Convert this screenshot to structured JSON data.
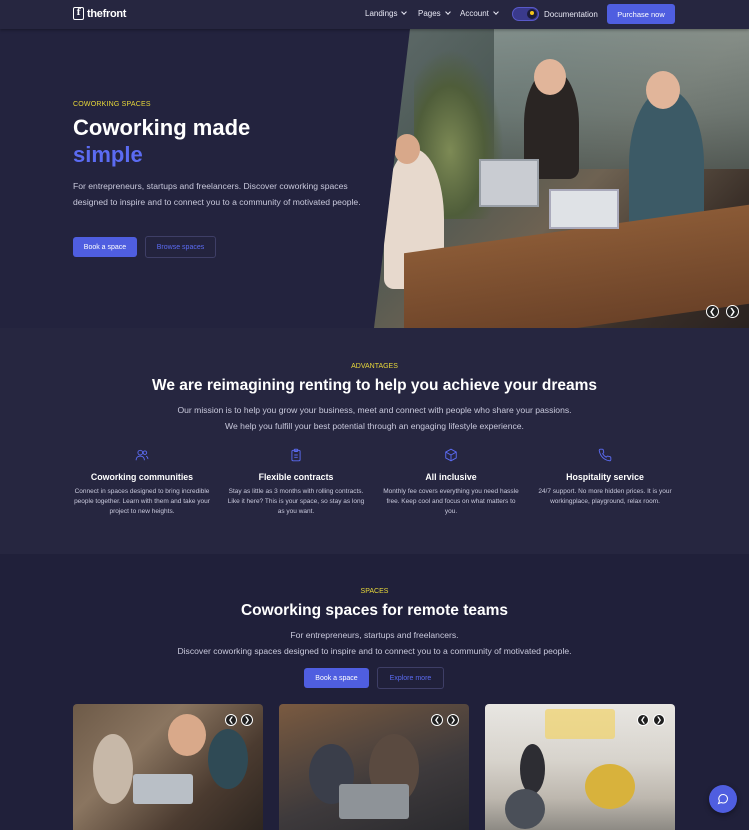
{
  "nav": {
    "logo_text": "thefront",
    "logo_mark": "f",
    "menu": [
      {
        "label": "Landings"
      },
      {
        "label": "Pages"
      },
      {
        "label": "Account"
      }
    ],
    "documentation_label": "Documentation",
    "purchase_label": "Purchase now"
  },
  "hero": {
    "eyebrow": "COWORKING SPACES",
    "title_line1": "Coworking made",
    "title_accent": "simple",
    "description": "For entrepreneurs, startups and freelancers. Discover coworking spaces designed to inspire and to connect you to a community of motivated people.",
    "primary_button": "Book a space",
    "secondary_button": "Browse spaces"
  },
  "advantages": {
    "eyebrow": "ADVANTAGES",
    "title": "We are reimagining renting to help you achieve your dreams",
    "subtitle_line1": "Our mission is to help you grow your business, meet and connect with people who share your passions.",
    "subtitle_line2": "We help you fulfill your best potential through an engaging lifestyle experience.",
    "features": [
      {
        "icon": "people-icon",
        "title": "Coworking communities",
        "description": "Connect in spaces designed to bring incredible people together. Learn with them and take your project to new heights."
      },
      {
        "icon": "clipboard-icon",
        "title": "Flexible contracts",
        "description": "Stay as little as 3 months with rolling contracts. Like it here? This is your space, so stay as long as you want."
      },
      {
        "icon": "box-icon",
        "title": "All inclusive",
        "description": "Monthly fee covers everything you need hassle free. Keep cool and focus on what matters to you."
      },
      {
        "icon": "phone-icon",
        "title": "Hospitality service",
        "description": "24/7 support. No more hidden prices. It is your workingplace, playground, relax room."
      }
    ]
  },
  "spaces": {
    "eyebrow": "SPACES",
    "title": "Coworking spaces for remote teams",
    "subtitle_line1": "For entrepreneurs, startups and freelancers.",
    "subtitle_line2": "Discover coworking spaces designed to inspire and to connect you to a community of motivated people.",
    "primary_button": "Book a space",
    "secondary_button": "Explore more"
  },
  "colors": {
    "accent": "#4f5ee0",
    "accent_text": "#5b6bf2",
    "eyebrow": "#e8d83a",
    "background": "#20203a"
  }
}
